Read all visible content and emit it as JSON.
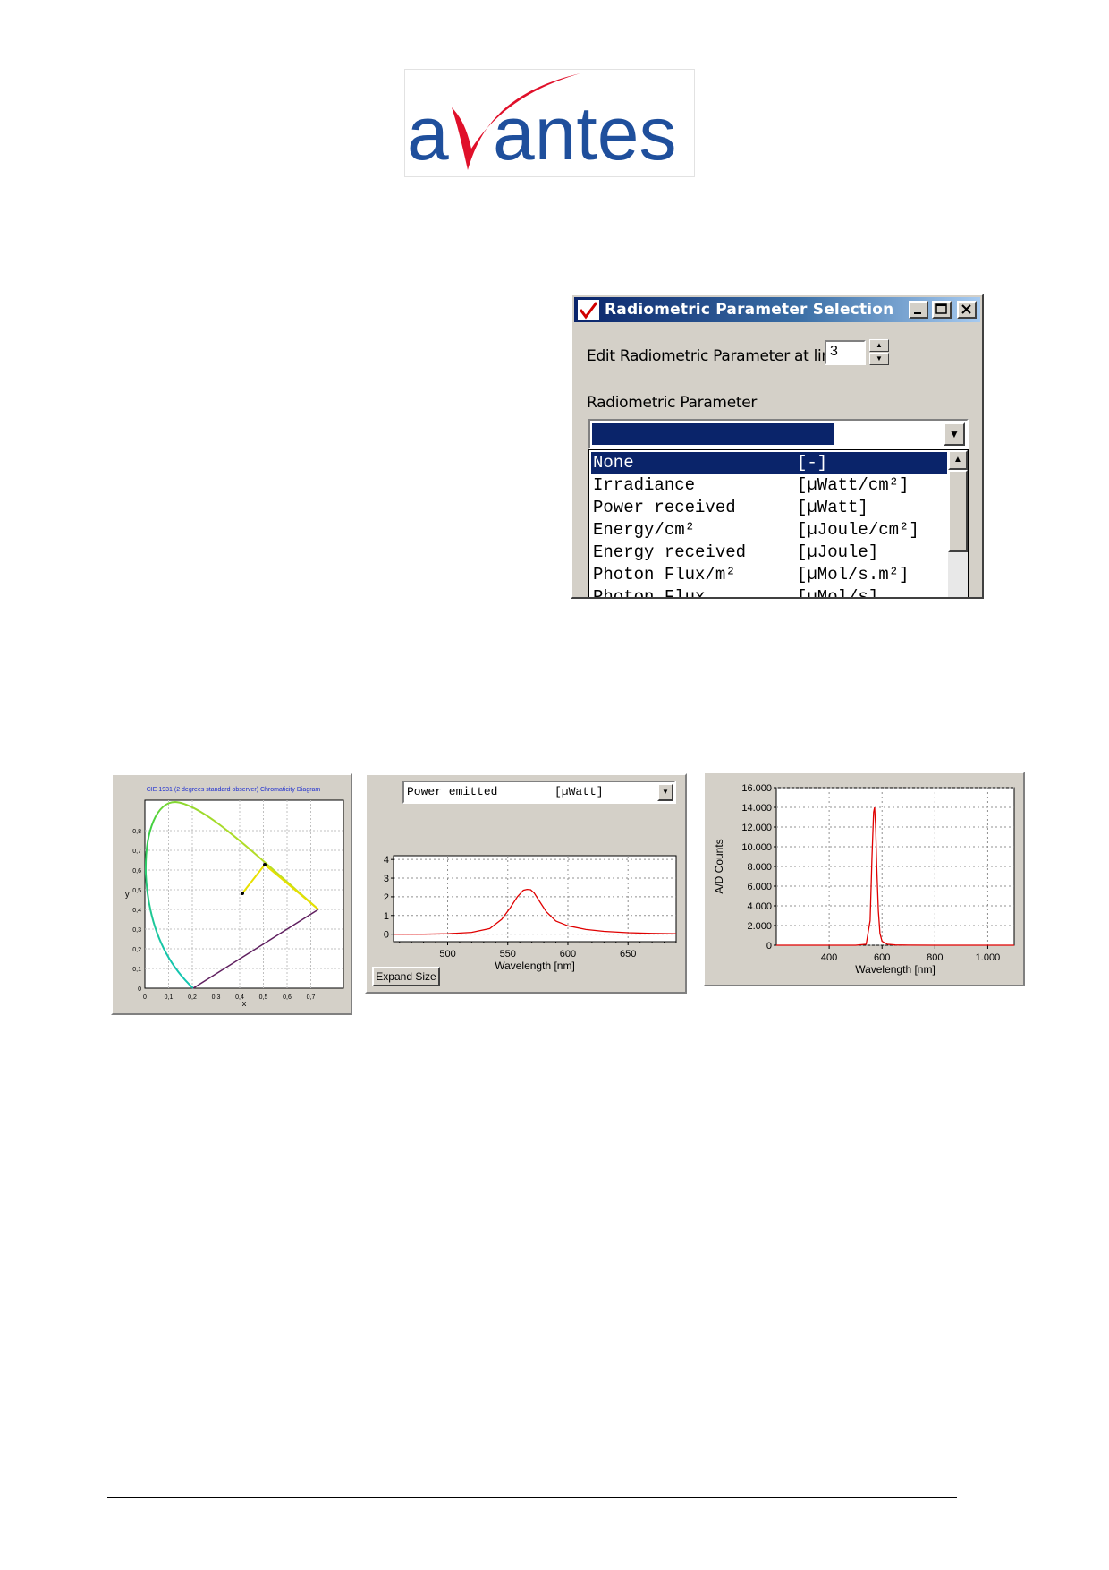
{
  "logo": {
    "text": "avantes",
    "colors": {
      "blue": "#1f4f9c",
      "red": "#e0102a"
    }
  },
  "dialog": {
    "title": "Radiometric Parameter Selection",
    "line_label": "Edit Radiometric Parameter at line:",
    "line_value": "3",
    "param_label": "Radiometric Parameter",
    "selected": {
      "name": "None",
      "unit": "[-]"
    },
    "options": [
      {
        "name": "None",
        "unit": "[-]"
      },
      {
        "name": "Irradiance",
        "unit": "[µWatt/cm²]"
      },
      {
        "name": "Power received",
        "unit": "[µWatt]"
      },
      {
        "name": "Energy/cm²",
        "unit": "[µJoule/cm²]"
      },
      {
        "name": "Energy received",
        "unit": "[µJoule]"
      },
      {
        "name": "Photon Flux/m²",
        "unit": "[µMol/s.m²]"
      },
      {
        "name": "Photon Flux",
        "unit": "[µMol/s]"
      }
    ],
    "colors": {
      "title_start": "#0a246a",
      "title_end": "#a6caf0",
      "selection": "#0a246a"
    }
  },
  "chromaticity": {
    "title": "CIE 1931 (2 degrees standard observer) Chromaticity Diagram",
    "xlabel": "x",
    "ylabel": "y",
    "xticks": [
      "0",
      "0,1",
      "0,2",
      "0,3",
      "0,4",
      "0,5",
      "0,6",
      "0,7"
    ],
    "yticks": [
      "0",
      "0,1",
      "0,2",
      "0,3",
      "0,4",
      "0,5",
      "0,6",
      "0,7",
      "0,8"
    ]
  },
  "power_panel": {
    "combo_name": "Power emitted",
    "combo_unit": "[µWatt]",
    "button": "Expand Size",
    "chart_data": {
      "type": "line",
      "xlabel": "Wavelength [nm]",
      "xticks": [
        "500",
        "550",
        "600",
        "650"
      ],
      "yticks": [
        "0",
        "1",
        "2",
        "3",
        "4"
      ],
      "xlim": [
        455,
        690
      ],
      "ylim": [
        -0.4,
        4.2
      ],
      "x": [
        455,
        480,
        500,
        520,
        535,
        545,
        552,
        558,
        563,
        566,
        569,
        572,
        576,
        582,
        590,
        600,
        615,
        630,
        650,
        670,
        690
      ],
      "y": [
        0,
        0,
        0.02,
        0.1,
        0.3,
        0.8,
        1.4,
        2.0,
        2.35,
        2.4,
        2.38,
        2.2,
        1.8,
        1.2,
        0.7,
        0.45,
        0.25,
        0.15,
        0.08,
        0.04,
        0.02
      ],
      "line_color": "#e00000"
    }
  },
  "counts_panel": {
    "chart_data": {
      "type": "line",
      "ylabel": "A/D Counts",
      "xlabel": "Wavelength [nm]",
      "xticks": [
        "400",
        "600",
        "800",
        "1.000"
      ],
      "yticks": [
        "0",
        "2.000",
        "4.000",
        "6.000",
        "8.000",
        "10.000",
        "12.000",
        "14.000",
        "16.000"
      ],
      "xlim": [
        200,
        1100
      ],
      "ylim": [
        0,
        16000
      ],
      "x": [
        200,
        300,
        400,
        500,
        540,
        555,
        562,
        568,
        572,
        576,
        580,
        586,
        592,
        600,
        620,
        650,
        700,
        800,
        900,
        1000,
        1100
      ],
      "y": [
        0,
        0,
        0,
        0,
        100,
        2500,
        9000,
        13500,
        14000,
        12000,
        8000,
        3500,
        1200,
        400,
        100,
        30,
        10,
        0,
        0,
        0,
        0
      ],
      "line_color": "#e00000"
    }
  }
}
